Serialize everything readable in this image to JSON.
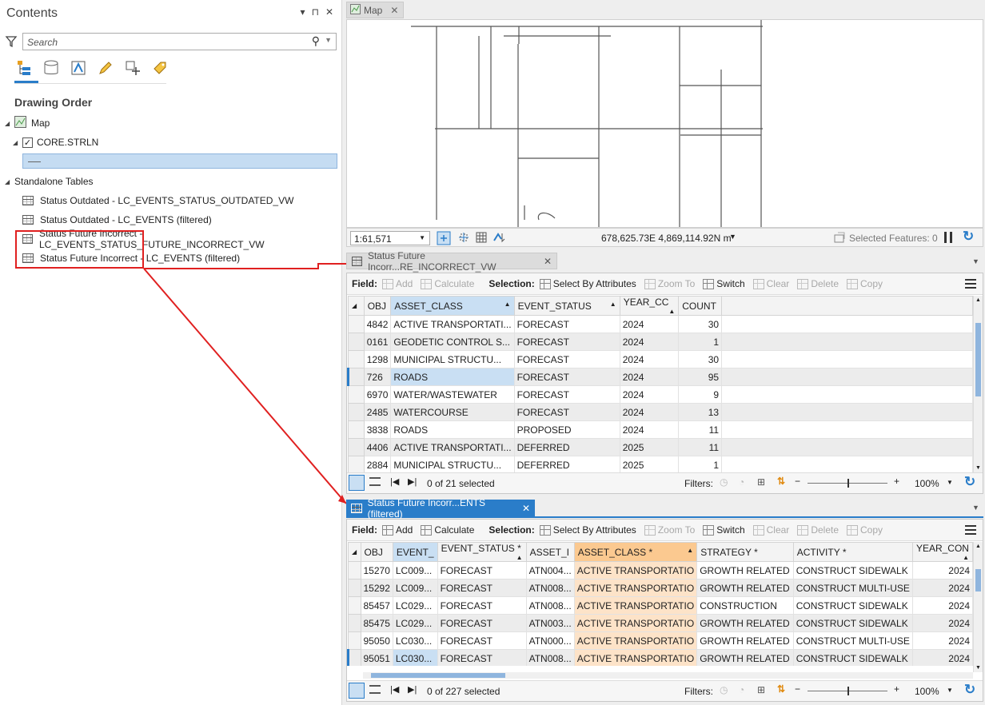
{
  "contents": {
    "title": "Contents",
    "pane_controls": [
      "▾",
      "⊓",
      "✕"
    ],
    "search_placeholder": "Search",
    "section_title": "Drawing Order",
    "map_item": "Map",
    "layer_item": "CORE.STRLN",
    "standalone_header": "Standalone Tables",
    "tables": [
      "Status Outdated - LC_EVENTS_STATUS_OUTDATED_VW",
      "Status Outdated - LC_EVENTS (filtered)",
      "Status Future Incorrect - LC_EVENTS_STATUS_FUTURE_INCORRECT_VW",
      "Status Future Incorrect - LC_EVENTS (filtered)"
    ]
  },
  "map": {
    "tab_label": "Map",
    "scale": "1:61,571",
    "coordinates": "678,625.73E 4,869,114.92N m",
    "selected_features": "Selected Features: 0"
  },
  "table1": {
    "tab_label": "Status Future Incorr...RE_INCORRECT_VW",
    "toolbar": {
      "field": "Field:",
      "add": "Add",
      "calculate": "Calculate",
      "selection": "Selection:",
      "select_by_attributes": "Select By Attributes",
      "zoom_to": "Zoom To",
      "switch": "Switch",
      "clear": "Clear",
      "delete": "Delete",
      "copy": "Copy"
    },
    "columns": [
      "OBJ",
      "ASSET_CLASS",
      "EVENT_STATUS",
      "YEAR_CC",
      "COUNT"
    ],
    "rows": [
      [
        "4842",
        "ACTIVE TRANSPORTATI...",
        "FORECAST",
        "2024",
        "30"
      ],
      [
        "0161",
        "GEODETIC CONTROL S...",
        "FORECAST",
        "2024",
        "1"
      ],
      [
        "1298",
        "MUNICIPAL STRUCTU...",
        "FORECAST",
        "2024",
        "30"
      ],
      [
        "726",
        "ROADS",
        "FORECAST",
        "2024",
        "95"
      ],
      [
        "6970",
        "WATER/WASTEWATER",
        "FORECAST",
        "2024",
        "9"
      ],
      [
        "2485",
        "WATERCOURSE",
        "FORECAST",
        "2024",
        "13"
      ],
      [
        "3838",
        "ROADS",
        "PROPOSED",
        "2024",
        "11"
      ],
      [
        "4406",
        "ACTIVE TRANSPORTATI...",
        "DEFERRED",
        "2025",
        "11"
      ],
      [
        "2884",
        "MUNICIPAL STRUCTU...",
        "DEFERRED",
        "2025",
        "1"
      ]
    ],
    "selected_text": "0 of 21 selected",
    "filters_label": "Filters:",
    "zoom": "100%"
  },
  "table2": {
    "tab_label": "Status Future Incorr...ENTS (filtered)",
    "toolbar": {
      "field": "Field:",
      "add": "Add",
      "calculate": "Calculate",
      "selection": "Selection:",
      "select_by_attributes": "Select By Attributes",
      "zoom_to": "Zoom To",
      "switch": "Switch",
      "clear": "Clear",
      "delete": "Delete",
      "copy": "Copy"
    },
    "columns": [
      "OBJ",
      "EVENT_",
      "EVENT_STATUS *",
      "ASSET_I",
      "ASSET_CLASS *",
      "STRATEGY *",
      "ACTIVITY *",
      "YEAR_CON"
    ],
    "rows": [
      [
        "15270",
        "LC009...",
        "FORECAST",
        "ATN004...",
        "ACTIVE TRANSPORTATIO",
        "GROWTH RELATED",
        "CONSTRUCT SIDEWALK",
        "2024"
      ],
      [
        "15292",
        "LC009...",
        "FORECAST",
        "ATN008...",
        "ACTIVE TRANSPORTATIO",
        "GROWTH RELATED",
        "CONSTRUCT MULTI-USE",
        "2024"
      ],
      [
        "85457",
        "LC029...",
        "FORECAST",
        "ATN008...",
        "ACTIVE TRANSPORTATIO",
        "CONSTRUCTION",
        "CONSTRUCT SIDEWALK",
        "2024"
      ],
      [
        "85475",
        "LC029...",
        "FORECAST",
        "ATN003...",
        "ACTIVE TRANSPORTATIO",
        "GROWTH RELATED",
        "CONSTRUCT SIDEWALK",
        "2024"
      ],
      [
        "95050",
        "LC030...",
        "FORECAST",
        "ATN000...",
        "ACTIVE TRANSPORTATIO",
        "GROWTH RELATED",
        "CONSTRUCT MULTI-USE",
        "2024"
      ],
      [
        "95051",
        "LC030...",
        "FORECAST",
        "ATN008...",
        "ACTIVE TRANSPORTATIO",
        "GROWTH RELATED",
        "CONSTRUCT SIDEWALK",
        "2024"
      ]
    ],
    "selected_text": "0 of 227 selected",
    "filters_label": "Filters:",
    "zoom": "100%"
  },
  "colors": {
    "accent": "#2a7dc9",
    "annotation": "#e02020",
    "highlight_field": "#fbc990"
  }
}
